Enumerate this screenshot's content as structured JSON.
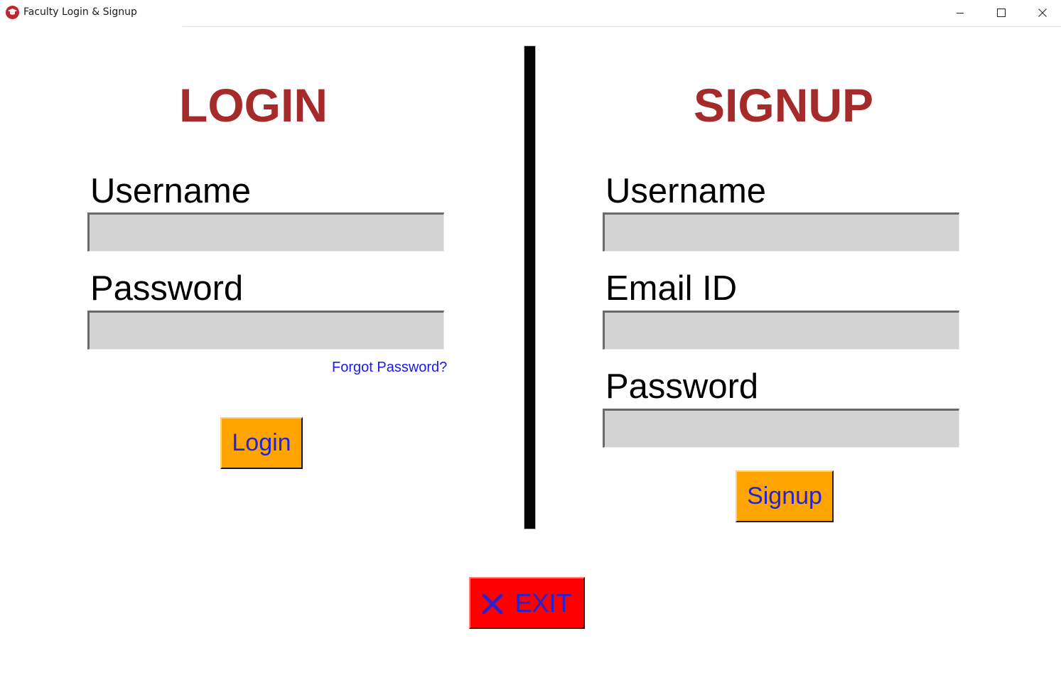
{
  "window": {
    "title": "Faculty Login & Signup",
    "app_icon": "graduation-cap-icon"
  },
  "login": {
    "heading": "LOGIN",
    "username_label": "Username",
    "username_value": "",
    "password_label": "Password",
    "password_value": "",
    "forgot_link": "Forgot Password?",
    "button_label": "Login"
  },
  "signup": {
    "heading": "SIGNUP",
    "username_label": "Username",
    "username_value": "",
    "email_label": "Email ID",
    "email_value": "",
    "password_label": "Password",
    "password_value": "",
    "button_label": "Signup"
  },
  "exit": {
    "icon": "x-icon",
    "label": "EXIT"
  },
  "colors": {
    "heading": "#a52a2a",
    "field_bg": "#d3d3d3",
    "button_bg": "#ffa500",
    "button_text": "#2424d6",
    "exit_bg": "#ff0000",
    "link": "#1a1ae6",
    "divider": "#050505"
  }
}
